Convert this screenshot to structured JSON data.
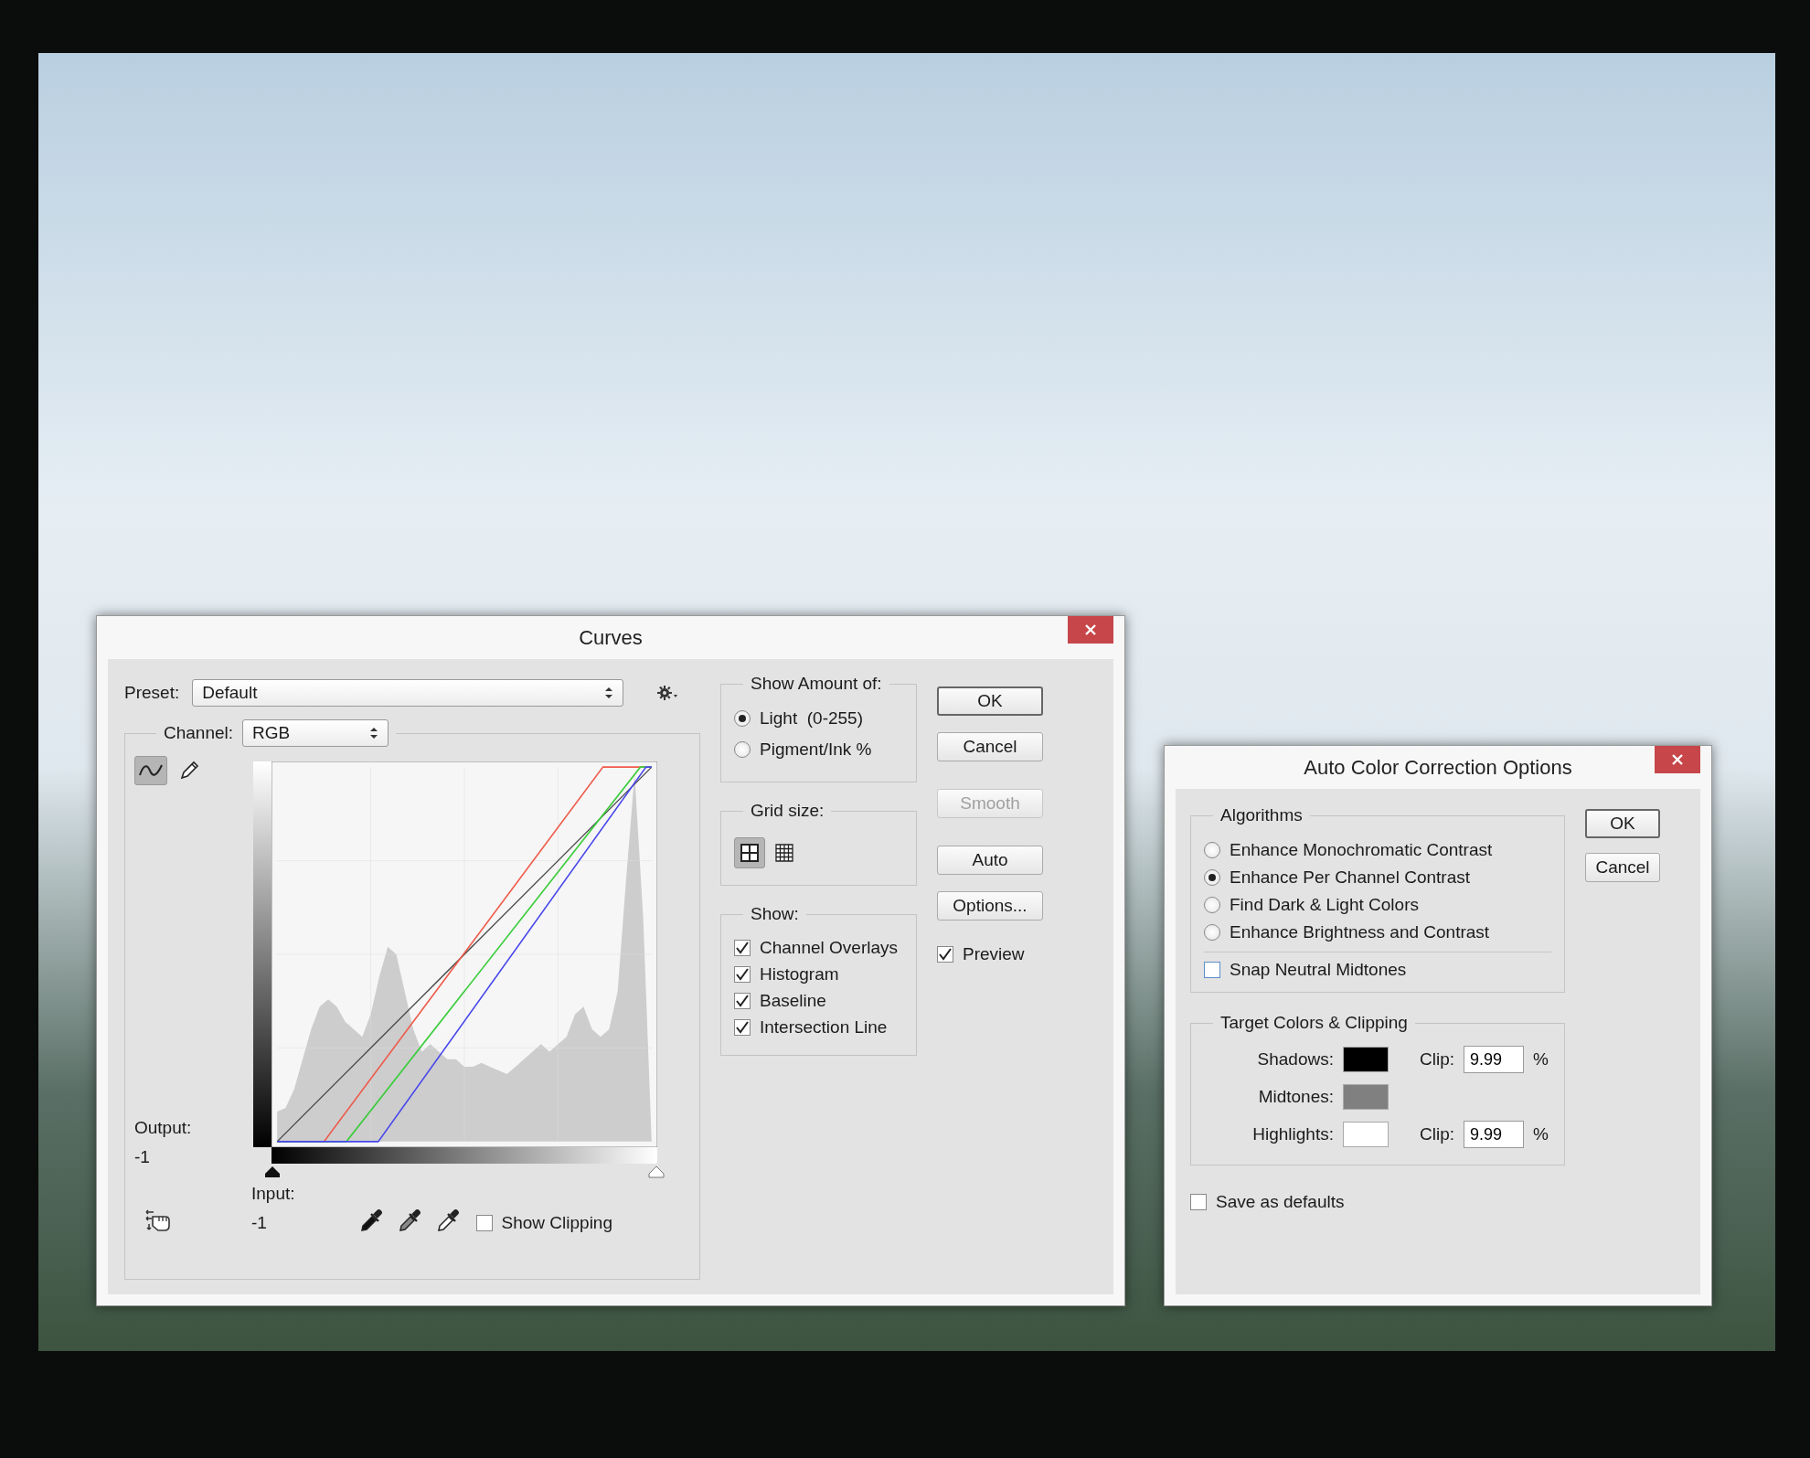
{
  "curves_dialog": {
    "title": "Curves",
    "preset": {
      "label": "Preset:",
      "value": "Default"
    },
    "channel": {
      "label": "Channel:",
      "value": "RGB"
    },
    "tools": [
      {
        "kind": "curve",
        "selected": true
      },
      {
        "kind": "pencil",
        "selected": false
      }
    ],
    "output": {
      "label": "Output:",
      "value": "-1"
    },
    "input": {
      "label": "Input:",
      "value": "-1"
    },
    "show_clipping": {
      "label": "Show Clipping",
      "checked": false
    },
    "show_amount": {
      "title": "Show Amount of:",
      "options": [
        {
          "label": "Light  (0-255)",
          "selected": true
        },
        {
          "label": "Pigment/Ink %",
          "selected": false
        }
      ]
    },
    "grid_size": {
      "title": "Grid size:",
      "options": [
        {
          "kind": "coarse",
          "selected": true
        },
        {
          "kind": "fine",
          "selected": false
        }
      ]
    },
    "show": {
      "title": "Show:",
      "options": [
        {
          "label": "Channel Overlays",
          "checked": true
        },
        {
          "label": "Histogram",
          "checked": true
        },
        {
          "label": "Baseline",
          "checked": true
        },
        {
          "label": "Intersection Line",
          "checked": true
        }
      ]
    },
    "buttons": [
      {
        "label": "OK",
        "disabled": false,
        "default": true
      },
      {
        "label": "Cancel",
        "disabled": false,
        "default": false
      },
      {
        "label": "Smooth",
        "disabled": true,
        "default": false
      },
      {
        "label": "Auto",
        "disabled": false,
        "default": false
      },
      {
        "label": "Options...",
        "disabled": false,
        "default": false
      }
    ],
    "preview": {
      "label": "Preview",
      "checked": true
    }
  },
  "auto_color_dialog": {
    "title": "Auto Color Correction Options",
    "algorithms": {
      "title": "Algorithms",
      "options": [
        {
          "label": "Enhance Monochromatic Contrast",
          "selected": false
        },
        {
          "label": "Enhance Per Channel Contrast",
          "selected": true
        },
        {
          "label": "Find Dark & Light Colors",
          "selected": false
        },
        {
          "label": "Enhance Brightness and Contrast",
          "selected": false
        }
      ]
    },
    "snap_neutral_midtones": {
      "label": "Snap Neutral Midtones",
      "checked": false
    },
    "targets": {
      "title": "Target Colors & Clipping",
      "rows": [
        {
          "label": "Shadows:",
          "color": "#000000",
          "clip_label": "Clip:",
          "clip": "9.99",
          "unit": "%"
        },
        {
          "label": "Midtones:",
          "color": "#808080"
        },
        {
          "label": "Highlights:",
          "color": "#ffffff",
          "clip_label": "Clip:",
          "clip": "9.99",
          "unit": "%"
        }
      ]
    },
    "save_as_defaults": {
      "label": "Save as defaults",
      "checked": false
    },
    "buttons": [
      {
        "label": "OK",
        "default": true
      },
      {
        "label": "Cancel",
        "default": false
      }
    ]
  }
}
